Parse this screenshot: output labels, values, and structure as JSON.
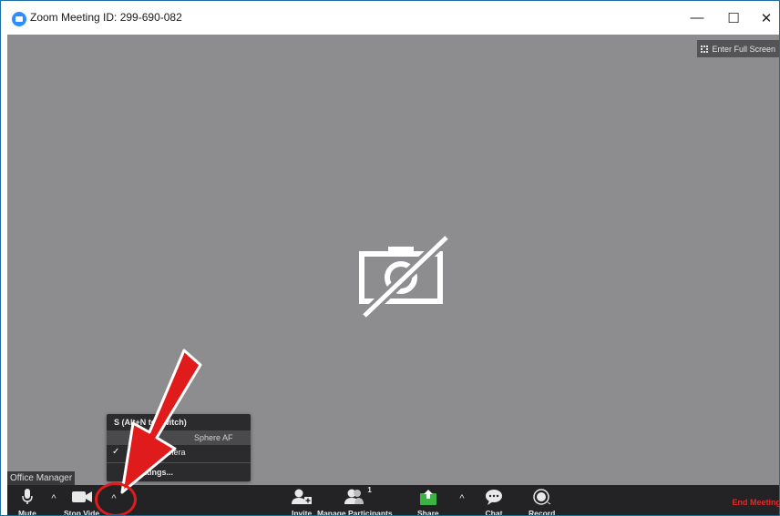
{
  "window": {
    "title": "Zoom Meeting ID: 299-690-082",
    "controls": {
      "minimize": "—",
      "maximize": "☐",
      "close": "✕"
    }
  },
  "video": {
    "fullscreen_label": "Enter Full Screen",
    "participant_name": "Office Manager",
    "camera_state_icon": "camera-off-icon"
  },
  "camera_menu": {
    "header": "S                (Alt+N to switch)",
    "items": [
      {
        "label": "Sphere AF",
        "selected": false
      },
      {
        "label": "mera",
        "selected": true
      },
      {
        "label": "o Settings..."
      }
    ],
    "check_mark": "✓"
  },
  "toolbar": {
    "mute": "Mute",
    "stop_video": "Stop Vide",
    "invite": "Invite",
    "manage_participants": "Manage Participants",
    "participant_count": "1",
    "share": "Share",
    "chat": "Chat",
    "record": "Record",
    "end_meeting": "End Meeting",
    "caret": "^"
  },
  "colors": {
    "video_bg": "#8d8d90",
    "toolbar_bg": "#232325",
    "share_green": "#3db346",
    "end_red": "#e02b2b",
    "annotation_red": "#e01b1b",
    "zoom_blue": "#2d8cff"
  }
}
